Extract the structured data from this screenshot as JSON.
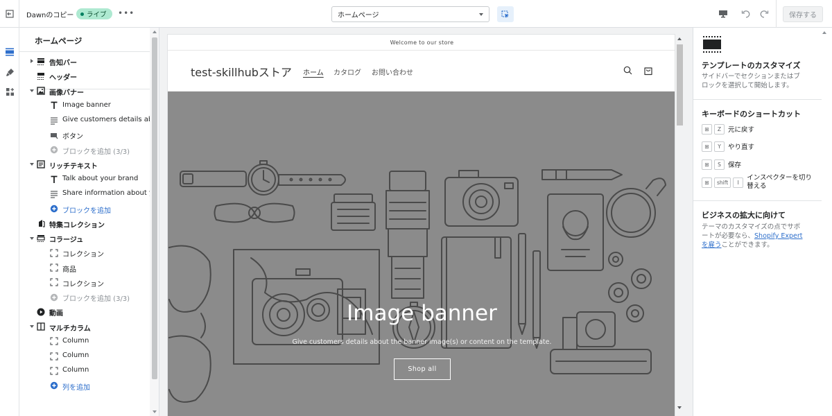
{
  "topbar": {
    "theme_name": "Dawnのコピー",
    "live_label": "ライブ",
    "more_label": "•••",
    "page_select_value": "ホームページ",
    "save_label": "保存する"
  },
  "sidebar": {
    "title": "ホームページ",
    "items": [
      {
        "label": "告知バー",
        "kind": "section",
        "caret": "right",
        "icon": "announcement-bar-icon"
      },
      {
        "label": "ヘッダー",
        "kind": "section",
        "caret": "none",
        "icon": "header-icon"
      },
      {
        "label": "画像バナー",
        "kind": "section",
        "caret": "down",
        "icon": "image-icon"
      },
      {
        "label": "Image banner",
        "kind": "block",
        "icon": "text-icon"
      },
      {
        "label": "Give customers details abo...",
        "kind": "block",
        "icon": "paragraph-icon"
      },
      {
        "label": "ボタン",
        "kind": "block",
        "icon": "button-icon"
      },
      {
        "label": "ブロックを追加 (3/3)",
        "kind": "add-disabled",
        "icon": "plus-circle-icon"
      },
      {
        "label": "リッチテキスト",
        "kind": "section",
        "caret": "down",
        "icon": "rich-text-icon"
      },
      {
        "label": "Talk about your brand",
        "kind": "block",
        "icon": "text-icon"
      },
      {
        "label": "Share information about y...",
        "kind": "block",
        "icon": "paragraph-icon"
      },
      {
        "label": "ブロックを追加",
        "kind": "add",
        "icon": "plus-circle-icon"
      },
      {
        "label": "特集コレクション",
        "kind": "section",
        "caret": "none",
        "icon": "collection-icon"
      },
      {
        "label": "コラージュ",
        "kind": "section",
        "caret": "down",
        "icon": "collage-icon"
      },
      {
        "label": "コレクション",
        "kind": "block",
        "icon": "placeholder-icon"
      },
      {
        "label": "商品",
        "kind": "block",
        "icon": "placeholder-icon"
      },
      {
        "label": "コレクション",
        "kind": "block",
        "icon": "placeholder-icon"
      },
      {
        "label": "ブロックを追加 (3/3)",
        "kind": "add-disabled",
        "icon": "plus-circle-icon"
      },
      {
        "label": "動画",
        "kind": "section",
        "caret": "none",
        "icon": "video-icon"
      },
      {
        "label": "マルチカラム",
        "kind": "section",
        "caret": "down",
        "icon": "multicolumn-icon"
      },
      {
        "label": "Column",
        "kind": "block",
        "icon": "placeholder-icon"
      },
      {
        "label": "Column",
        "kind": "block",
        "icon": "placeholder-icon"
      },
      {
        "label": "Column",
        "kind": "block",
        "icon": "placeholder-icon"
      },
      {
        "label": "列を追加",
        "kind": "add",
        "icon": "plus-circle-icon"
      }
    ]
  },
  "preview": {
    "announcement": "Welcome to our store",
    "store_name": "test-skillhubストア",
    "nav": [
      "ホーム",
      "カタログ",
      "お問い合わせ"
    ],
    "banner_heading": "Image banner",
    "banner_text": "Give customers details about the banner image(s) or content on the template.",
    "banner_button": "Shop all"
  },
  "right_panel": {
    "title": "テンプレートのカスタマイズ",
    "description": "サイドバーでセクションまたはブロックを選択して開始します。",
    "shortcuts_title": "キーボードのショートカット",
    "shortcuts": [
      {
        "keys": [
          "⊞",
          "Z"
        ],
        "label": "元に戻す"
      },
      {
        "keys": [
          "⊞",
          "Y"
        ],
        "label": "やり直す"
      },
      {
        "keys": [
          "⊞",
          "S"
        ],
        "label": "保存"
      },
      {
        "keys": [
          "⊞",
          "shift",
          "I"
        ],
        "label": "インスペクターを切り替える"
      }
    ],
    "business_title": "ビジネスの拡大に向けて",
    "business_text_before": "テーマのカスタマイズの点でサポートが必要なら、",
    "business_link": "Shopify Expertを雇う",
    "business_text_after": "ことができます。"
  },
  "colors": {
    "accent": "#2c6ecb",
    "live_badge": "#aee9d1",
    "banner_overlay": "#8b8b8b"
  }
}
